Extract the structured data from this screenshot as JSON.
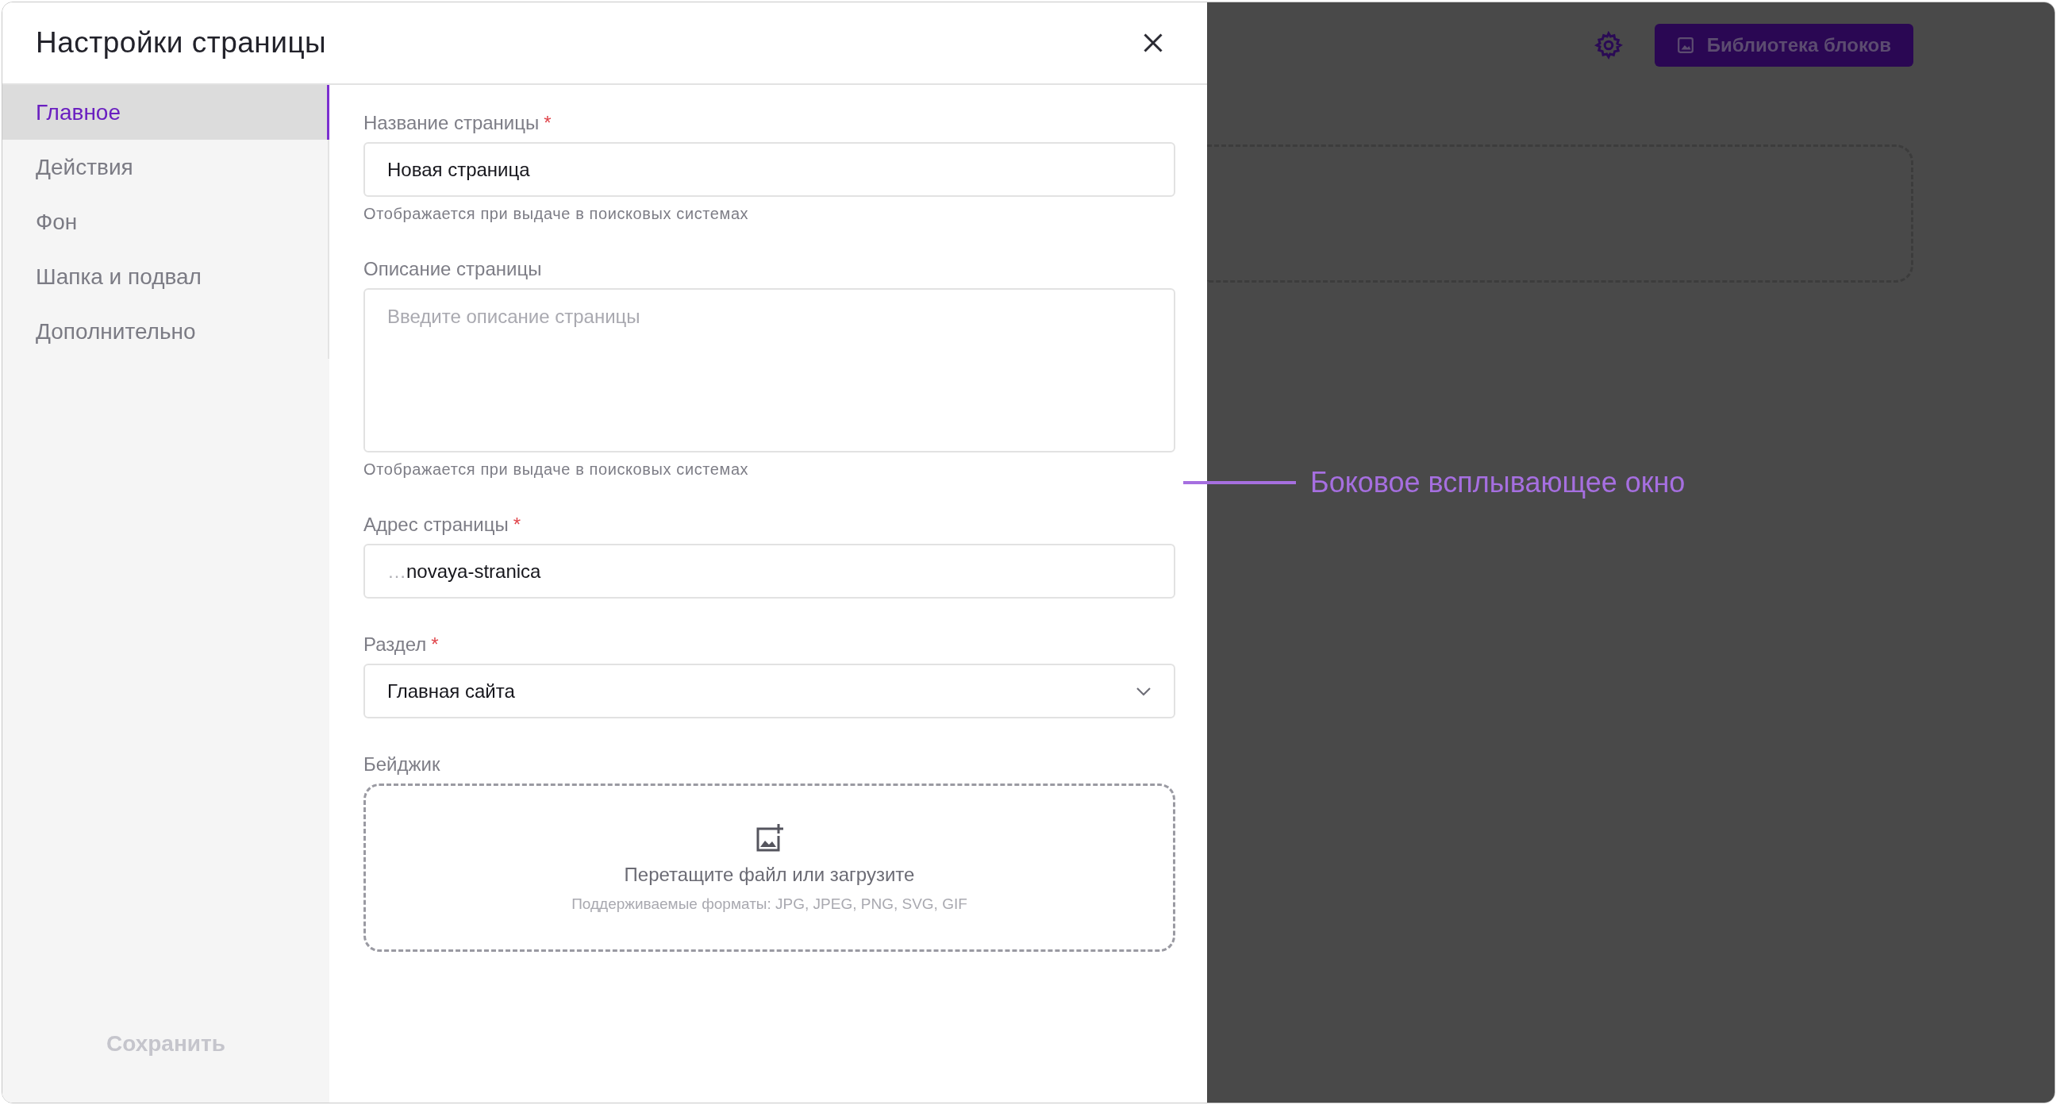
{
  "panel": {
    "title": "Настройки страницы",
    "tabs": [
      {
        "label": "Главное",
        "selected": true
      },
      {
        "label": "Действия",
        "selected": false
      },
      {
        "label": "Фон",
        "selected": false
      },
      {
        "label": "Шапка и подвал",
        "selected": false
      },
      {
        "label": "Дополнительно",
        "selected": false
      }
    ],
    "save_button": {
      "label": "Сохранить",
      "disabled": true
    },
    "fields": [
      {
        "kind": "text",
        "label": "Название страницы",
        "required_mark": "*",
        "value": "Новая страница",
        "hint": "Отображается при выдаче в поисковых системах"
      },
      {
        "kind": "textarea",
        "label": "Описание страницы",
        "placeholder": "Введите описание страницы",
        "hint": "Отображается при выдаче в поисковых системах"
      },
      {
        "kind": "url",
        "label": "Адрес страницы",
        "required_mark": "*",
        "prefix": "…",
        "value": "novaya-stranica"
      },
      {
        "kind": "select",
        "label": "Раздел",
        "required_mark": "*",
        "value": "Главная сайта"
      },
      {
        "kind": "upload",
        "label": "Бейджик",
        "prompt": "Перетащите файл или загрузите",
        "formats": "Поддерживаемые форматы: JPG, JPEG, PNG, SVG, GIF"
      }
    ]
  },
  "background": {
    "library_button": "Библиотека блоков"
  },
  "annotation": "Боковое всплывающее окно"
}
